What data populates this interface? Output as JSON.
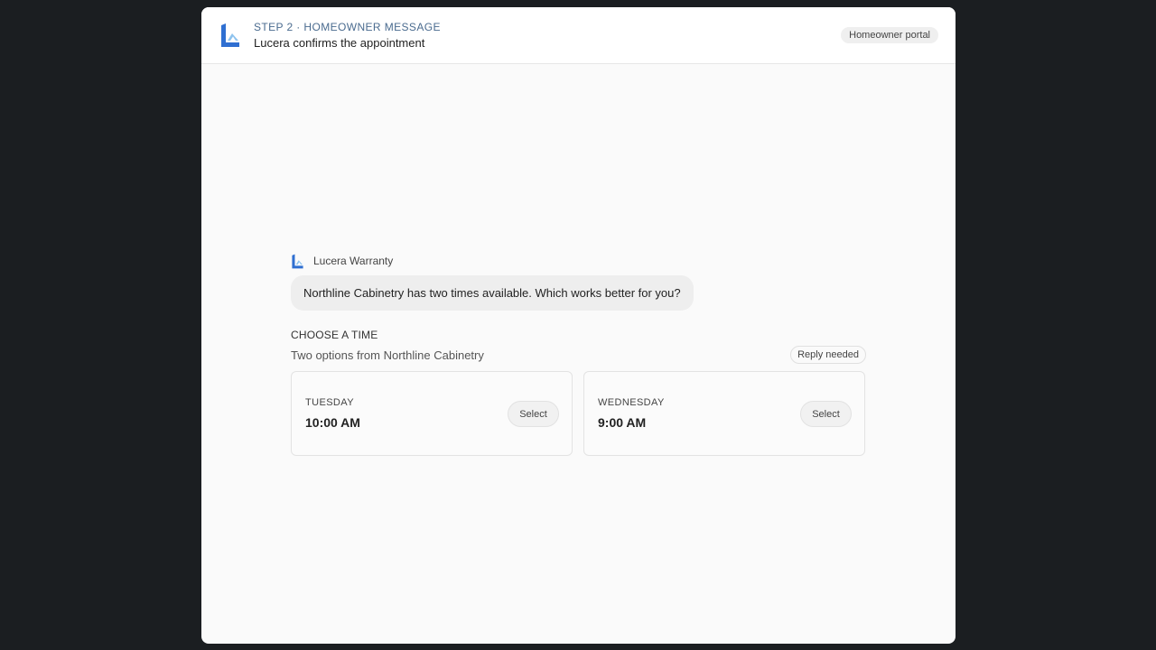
{
  "header": {
    "step": "STEP 2 · HOMEOWNER MESSAGE",
    "title": "Lucera confirms the appointment",
    "portal_badge": "Homeowner portal"
  },
  "message": {
    "sender": "Lucera Warranty",
    "text": "Northline Cabinetry has two times available. Which works better for you?"
  },
  "choose": {
    "heading": "CHOOSE A TIME",
    "subtitle": "Two options from Northline Cabinetry",
    "status_badge": "Reply needed",
    "slots": [
      {
        "day": "TUESDAY",
        "time": "10:00 AM",
        "button": "Select"
      },
      {
        "day": "WEDNESDAY",
        "time": "9:00 AM",
        "button": "Select"
      }
    ]
  },
  "colors": {
    "brand_blue": "#2f6fd1",
    "brand_light": "#8ec3ee",
    "step_text": "#4a6b8f"
  }
}
